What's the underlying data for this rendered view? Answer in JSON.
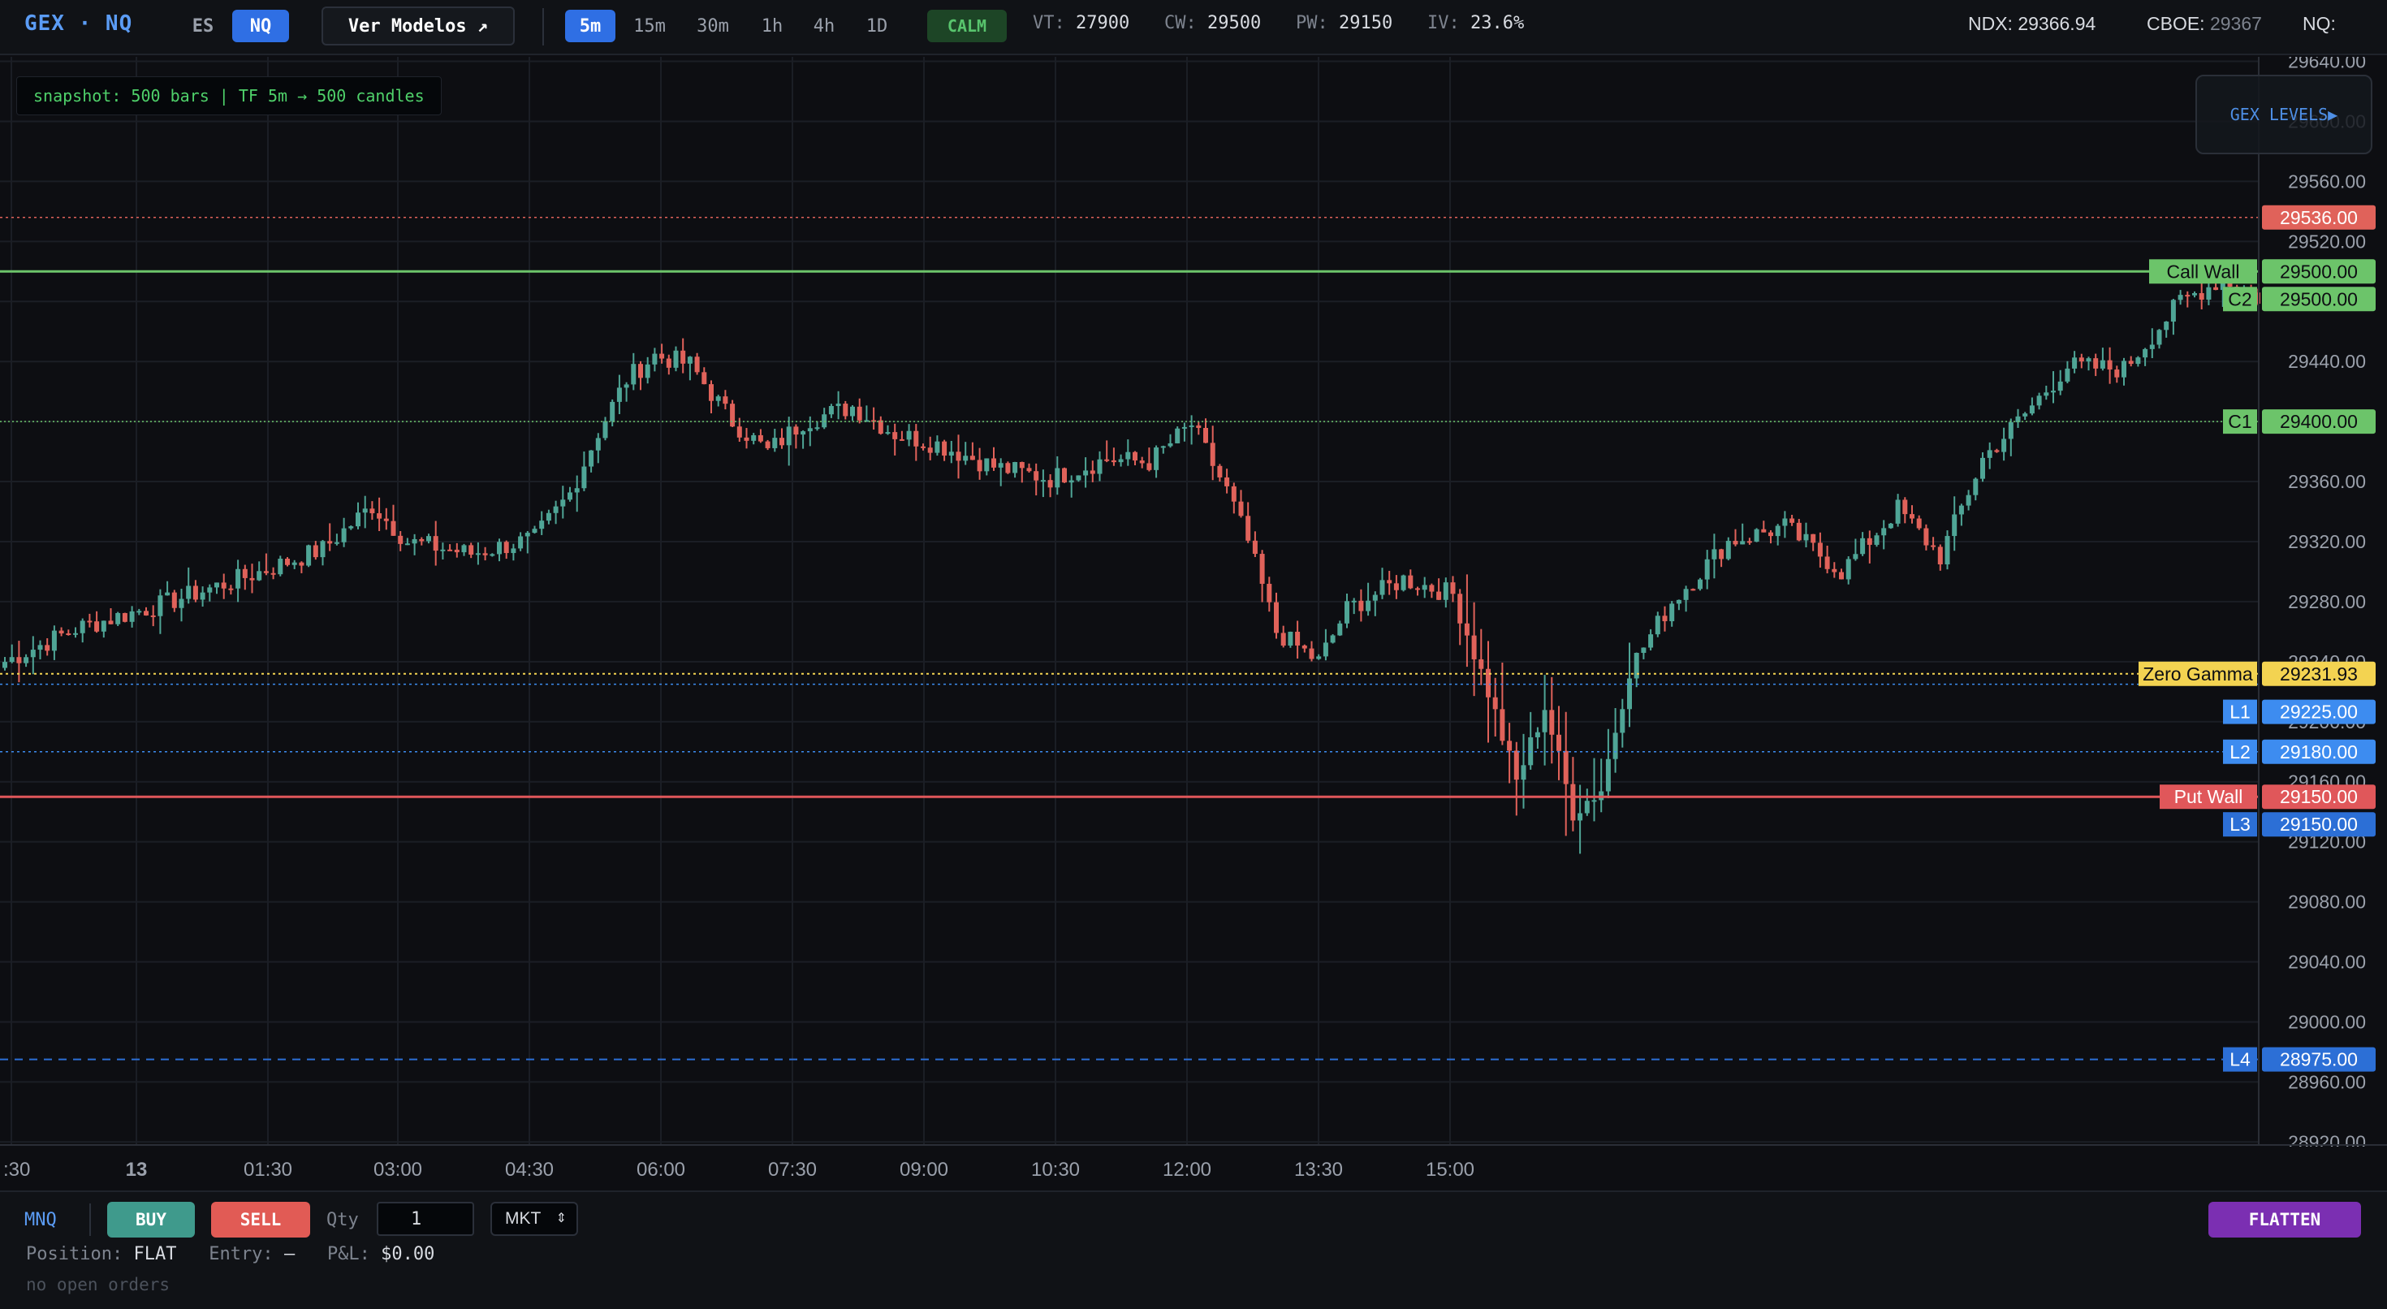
{
  "app": {
    "brand": "GEX · NQ",
    "symbols": [
      {
        "label": "ES",
        "active": false
      },
      {
        "label": "NQ",
        "active": true
      }
    ],
    "models_button": "Ver Modelos ↗",
    "timeframes": [
      {
        "label": "5m",
        "active": true
      },
      {
        "label": "15m",
        "active": false
      },
      {
        "label": "30m",
        "active": false
      },
      {
        "label": "1h",
        "active": false
      },
      {
        "label": "4h",
        "active": false
      },
      {
        "label": "1D",
        "active": false
      }
    ],
    "regime": "CALM",
    "stats": [
      {
        "label": "VT:",
        "value": "27900"
      },
      {
        "label": "CW:",
        "value": "29500"
      },
      {
        "label": "PW:",
        "value": "29150"
      },
      {
        "label": "IV:",
        "value": "23.6%"
      }
    ],
    "right_stats": {
      "ndx_label": "NDX:",
      "ndx_value": "29366.94",
      "cboe_label": "CBOE:",
      "cboe_value": "29367",
      "nq_label": "NQ:"
    }
  },
  "chart": {
    "snapshot_text": "snapshot: 500 bars | TF 5m → 500 candles",
    "gex_levels_button": "GEX LEVELS▶",
    "colors": {
      "up": "#4fa596",
      "down": "#e0625a",
      "call_wall": "#6cc46a",
      "put_wall": "#e0575a",
      "zero_gamma": "#f3d351",
      "level_blue": "#3d8cf0",
      "level_dark_blue": "#2c6fd6"
    }
  },
  "chart_data": {
    "type": "candlestick",
    "symbol": "NQ",
    "timeframe": "5m",
    "y_ticks": [
      28920,
      28960,
      29000,
      29040,
      29080,
      29120,
      29160,
      29200,
      29240,
      29280,
      29320,
      29360,
      29400,
      29440,
      29480,
      29520,
      29560,
      29600,
      29640
    ],
    "ylim": [
      28918,
      29643
    ],
    "x_tick_labels": [
      ":30",
      "13",
      "01:30",
      "03:00",
      "04:30",
      "06:00",
      "07:30",
      "09:00",
      "10:30",
      "12:00",
      "13:30",
      "15:00"
    ],
    "last_price": "29536.00",
    "levels": [
      {
        "name": "Call Wall",
        "value": 29500.0,
        "label": "29500.00",
        "style": "solid-green"
      },
      {
        "name": "C2",
        "value": 29500.0,
        "label": "29500.00",
        "style": "green"
      },
      {
        "name": "C1",
        "value": 29400.0,
        "label": "29400.00",
        "style": "dotted-green"
      },
      {
        "name": "Zero Gamma",
        "value": 29231.93,
        "label": "29231.93",
        "style": "dotted-yellow"
      },
      {
        "name": "L1",
        "value": 29225.0,
        "label": "29225.00",
        "style": "dotted-blue"
      },
      {
        "name": "L2",
        "value": 29180.0,
        "label": "29180.00",
        "style": "dotted-blue"
      },
      {
        "name": "Put Wall",
        "value": 29150.0,
        "label": "29150.00",
        "style": "solid-red"
      },
      {
        "name": "L3",
        "value": 29150.0,
        "label": "29150.00",
        "style": "dark-blue"
      },
      {
        "name": "L4",
        "value": 28975.0,
        "label": "28975.00",
        "style": "dashed-blue"
      }
    ],
    "price_path": [
      [
        0,
        29240
      ],
      [
        10,
        29262
      ],
      [
        22,
        29278
      ],
      [
        35,
        29298
      ],
      [
        45,
        29315
      ],
      [
        52,
        29344
      ],
      [
        57,
        29320
      ],
      [
        66,
        29312
      ],
      [
        75,
        29322
      ],
      [
        80,
        29352
      ],
      [
        84,
        29393
      ],
      [
        88,
        29428
      ],
      [
        92,
        29444
      ],
      [
        97,
        29438
      ],
      [
        103,
        29400
      ],
      [
        108,
        29380
      ],
      [
        113,
        29400
      ],
      [
        120,
        29410
      ],
      [
        126,
        29392
      ],
      [
        132,
        29385
      ],
      [
        140,
        29370
      ],
      [
        148,
        29362
      ],
      [
        156,
        29375
      ],
      [
        162,
        29373
      ],
      [
        168,
        29398
      ],
      [
        173,
        29354
      ],
      [
        176,
        29320
      ],
      [
        180,
        29260
      ],
      [
        186,
        29240
      ],
      [
        190,
        29275
      ],
      [
        198,
        29295
      ],
      [
        205,
        29285
      ],
      [
        210,
        29220
      ],
      [
        214,
        29160
      ],
      [
        218,
        29210
      ],
      [
        222,
        29140
      ],
      [
        226,
        29155
      ],
      [
        230,
        29235
      ],
      [
        236,
        29280
      ],
      [
        244,
        29320
      ],
      [
        252,
        29330
      ],
      [
        260,
        29300
      ],
      [
        268,
        29342
      ],
      [
        274,
        29310
      ],
      [
        280,
        29375
      ],
      [
        286,
        29405
      ],
      [
        292,
        29437
      ],
      [
        300,
        29435
      ],
      [
        308,
        29480
      ],
      [
        314,
        29495
      ],
      [
        322,
        29475
      ],
      [
        330,
        29480
      ],
      [
        338,
        29490
      ],
      [
        344,
        29530
      ],
      [
        348,
        29555
      ],
      [
        354,
        29525
      ],
      [
        362,
        29475
      ],
      [
        370,
        29525
      ],
      [
        378,
        29530
      ],
      [
        384,
        29528
      ],
      [
        388,
        29465
      ],
      [
        392,
        29470
      ],
      [
        396,
        29505
      ],
      [
        402,
        29522
      ],
      [
        408,
        29540
      ],
      [
        414,
        29536
      ]
    ]
  },
  "order_panel": {
    "instrument": "MNQ",
    "buy_label": "BUY",
    "sell_label": "SELL",
    "qty_label": "Qty",
    "qty_value": "1",
    "order_type": "MKT",
    "flatten_label": "FLATTEN",
    "position_label": "Position:",
    "position_value": "FLAT",
    "entry_label": "Entry:",
    "entry_value": "—",
    "pnl_label": "P&L:",
    "pnl_value": "$0.00",
    "orders_text": "no open orders"
  }
}
